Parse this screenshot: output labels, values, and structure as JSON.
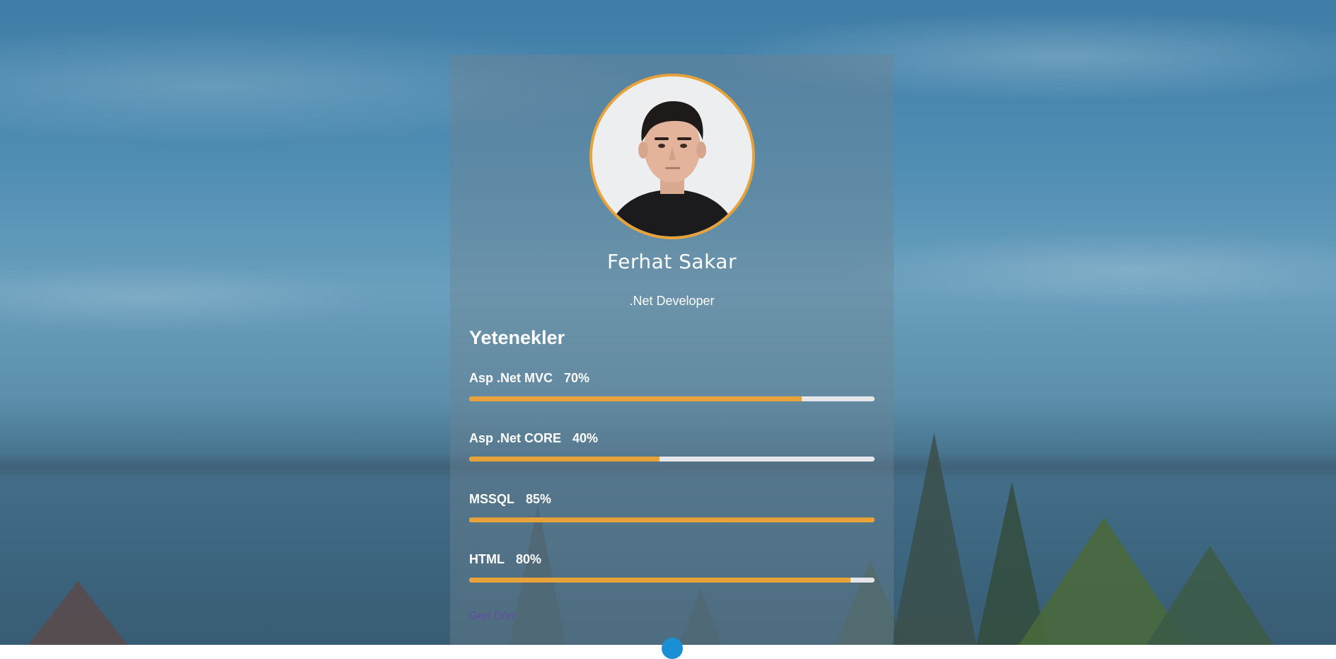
{
  "profile": {
    "name": "Ferhat Sakar",
    "title": ".Net Developer"
  },
  "skills": {
    "heading": "Yetenekler",
    "items": [
      {
        "label": "Asp .Net MVC",
        "percent_text": "70%",
        "fill": 0.82
      },
      {
        "label": "Asp .Net CORE",
        "percent_text": "40%",
        "fill": 0.47
      },
      {
        "label": "MSSQL",
        "percent_text": "85%",
        "fill": 1.0
      },
      {
        "label": "HTML",
        "percent_text": "80%",
        "fill": 0.94
      }
    ]
  },
  "footer": {
    "back_link": "Geri Dön"
  },
  "colors": {
    "accent": "#e8a23a",
    "track": "#e4e6ea",
    "link": "#6a3fb0",
    "scroll_button": "#1a8fd6"
  }
}
